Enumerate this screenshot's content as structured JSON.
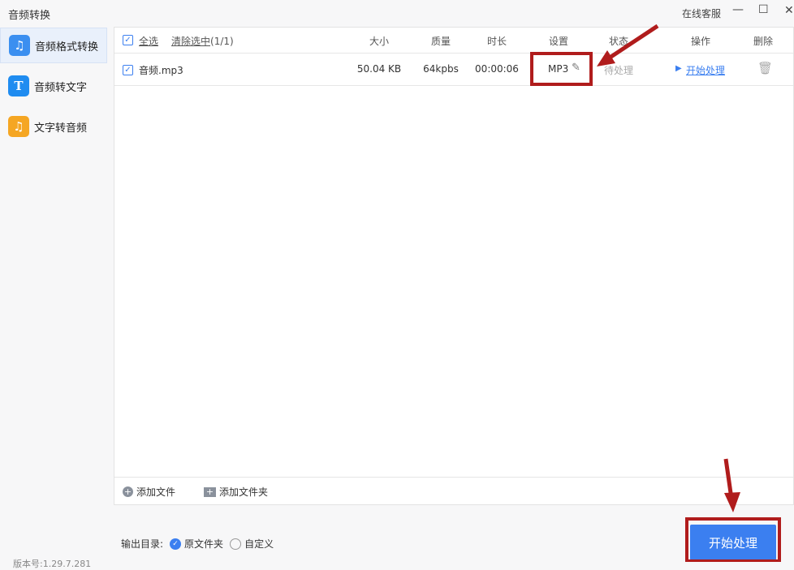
{
  "window": {
    "title": "音频转换",
    "support": "在线客服",
    "minimize": "—",
    "maximize": "☐",
    "close": "✕",
    "version": "版本号:1.29.7.281"
  },
  "sidebar": {
    "items": [
      {
        "label": "音频格式转换",
        "icon": "♫"
      },
      {
        "label": "音频转文字",
        "icon": "T"
      },
      {
        "label": "文字转音频",
        "icon": "♫"
      }
    ]
  },
  "list": {
    "select_all": "全选",
    "clear_selection": "清除选中",
    "selection_count": "(1/1)",
    "columns": [
      "大小",
      "质量",
      "时长",
      "设置",
      "状态",
      "操作",
      "删除"
    ],
    "rows": [
      {
        "name": "音频.mp3",
        "size": "50.04 KB",
        "quality": "64kpbs",
        "duration": "00:00:06",
        "format": "MP3",
        "status": "待处理",
        "action": "开始处理"
      }
    ]
  },
  "bottom": {
    "add_file": "添加文件",
    "add_folder": "添加文件夹"
  },
  "output": {
    "label": "输出目录:",
    "option_original": "原文件夹",
    "option_custom": "自定义"
  },
  "start_button": "开始处理",
  "colors": {
    "accent": "#3b7ff0",
    "annotation": "#b01c1c"
  }
}
